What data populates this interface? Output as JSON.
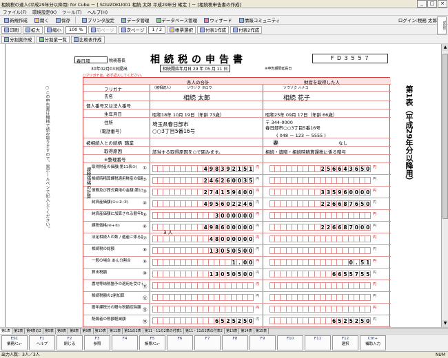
{
  "window": {
    "title": "相続税の達人(平成29年分以降用) for Cube － [ SOUZOKU001 相続 太郎 平成29年分 確定 ] － [相続税申告書の作成]"
  },
  "menu": [
    "ファイル(F)",
    "環境設定(K)",
    "ツール(T)",
    "ヘルプ(H)"
  ],
  "toolbar1": [
    {
      "label": "新規作成",
      "icon": "new-file-icon"
    },
    {
      "label": "開く",
      "icon": "open-folder-icon"
    },
    {
      "label": "保存",
      "icon": "save-icon"
    },
    {
      "label": "プリンタ設定",
      "icon": "printer-icon"
    },
    {
      "label": "データ管理",
      "icon": "database-icon"
    },
    {
      "label": "データベース管理",
      "icon": "database-manage-icon"
    },
    {
      "label": "ウィザード",
      "icon": "wizard-icon"
    },
    {
      "label": "情報コミュニティ",
      "icon": "community-icon"
    }
  ],
  "login": "ログイン:税務 太郎",
  "toolbar2": {
    "print": "印刷",
    "zoom_in": "拡大",
    "zoom_out": "縮小",
    "zoom": "100 %",
    "prev": "前ページ",
    "next": "次ページ",
    "page": "1 / 2",
    "sheet_select": "帳票選択",
    "attach_create": "付表1作成",
    "attach_create2": "付表2作成"
  },
  "toolbar3": {
    "split": "分割業作成",
    "split2": "分割業一覧",
    "compare": "比較表作成"
  },
  "tassei": "TASSEI",
  "form": {
    "title": "相続税の申告書",
    "fd": "ＦＤ３５５７",
    "office": "春日部",
    "office_label": "税務署長",
    "date_text": "30年02月03日提出",
    "death_date": "相続開始年月日 29 年 05 月 11 日",
    "page_label": "※申告期限延長日",
    "note": "○フリガナは、必ず記入してください。",
    "vertical_left": "○この申告書は機械で読み取りますので、黒ボールペンで記入してください。",
    "heir_header": "各人の合計",
    "prop_header": "財産を取得した人",
    "labels": {
      "furigana": "フリガナ",
      "name": "氏名",
      "mynumber": "個人番号又は法人番号",
      "birth": "生年月日",
      "address": "住所",
      "phone": "（電話番号）",
      "relation": "被相続人との続柄",
      "job": "職業",
      "cause": "取得原因",
      "ref": "※整理番号"
    },
    "deceased": {
      "kana": "ソウゾク タロウ",
      "name": "相続 太郎",
      "birth": "昭和18年 10月 19日（年齢 73歳）",
      "address1": "埼玉県春日部市",
      "address2": "○○3丁目5番16号",
      "tag": "（被相続人）"
    },
    "heir": {
      "kana": "ソウゾク ハナコ",
      "name": "相続 花子",
      "birth": "昭和25年 09月 17日（年齢 66歳）",
      "zip": "〒 344-0000",
      "address": "春日部市○○3丁目5番16号",
      "phone": "( 048 － 123 － 5555 )",
      "relation": "妻",
      "job": "なし",
      "cause": "相続・遺贈・相続時精算課税に係る贈与",
      "cause_all": "該当する取得原因を○で囲みます。"
    },
    "rows": [
      {
        "no": "①",
        "label": "取得財産の価額(第11表③)",
        "total": "498392151",
        "heir": "256643650"
      },
      {
        "no": "②",
        "label": "相続時精算課税適用財産の価額(第11の2表1⑦)",
        "total": "246260035",
        "heir": ""
      },
      {
        "no": "③",
        "label": "債務及び葬式費用の金額(第13表3⑦)",
        "total": "274159400",
        "heir": "335960000"
      },
      {
        "no": "④",
        "label": "純資産価額(①+②-③)",
        "total": "495602246",
        "heir": "226687650"
      },
      {
        "no": "⑤",
        "label": "純資産価額に加算される暦年課税分の贈与財産価額",
        "total": "3000000",
        "heir": ""
      },
      {
        "no": "⑥",
        "label": "課税価格(④+⑤)",
        "total": "498600000",
        "heir": "226687000"
      },
      {
        "no": "⑦",
        "label": "法定相続人の数 / 遺産に係る基礎控除額",
        "total": "48000000",
        "heir": ""
      },
      {
        "no": "⑧",
        "label": "相続税の総額",
        "total": "13050500",
        "heir": ""
      },
      {
        "no": "⑨",
        "label": "一般の場合 あん分割合",
        "total": "1.00",
        "heir": "0.51"
      },
      {
        "no": "⑩",
        "label": "算出税額",
        "total": "13050500",
        "heir": "6655755"
      },
      {
        "no": "⑪",
        "label": "農地等納税猶予の適用を受ける場合",
        "total": "",
        "heir": ""
      },
      {
        "no": "⑫",
        "label": "相続税額の2割加算",
        "total": "",
        "heir": ""
      },
      {
        "no": "⑬",
        "label": "暦年課税分の贈与税額控除額",
        "total": "",
        "heir": ""
      },
      {
        "no": "⑭",
        "label": "配偶者の税額軽減額",
        "total": "6525250",
        "heir": "6525250"
      }
    ],
    "rows_label": "課税価格の計算",
    "heirs_count": "3 人",
    "side_title": "第1表（平成29年分以降用）"
  },
  "tabs": [
    "第1表",
    "第2表",
    "第4表の2",
    "第5表",
    "第6表",
    "第8表",
    "第9表",
    "第10表",
    "第11表",
    "第11の2表",
    "第11・11の2表の付表1",
    "第11・11の2表の付表2",
    "第13表",
    "第14表",
    "第15表"
  ],
  "fkeys": [
    {
      "k": "ESC",
      "l": "業務ﾒﾆｭｰ"
    },
    {
      "k": "F1",
      "l": "ヘルプ"
    },
    {
      "k": "F2",
      "l": "閉じる"
    },
    {
      "k": "F3",
      "l": "参照"
    },
    {
      "k": "F4",
      "l": ""
    },
    {
      "k": "F5",
      "l": "帳票ﾒﾆｭｰ"
    },
    {
      "k": "F6",
      "l": ""
    },
    {
      "k": "F7",
      "l": ""
    },
    {
      "k": "F8",
      "l": ""
    },
    {
      "k": "F9",
      "l": ""
    },
    {
      "k": "F10",
      "l": ""
    },
    {
      "k": "F11",
      "l": ""
    },
    {
      "k": "F12",
      "l": "選択"
    },
    {
      "k": "Ctrl+",
      "l": "補助入力"
    }
  ],
  "status": {
    "text": "出力人数：3人／3人",
    "mode": "NUM"
  }
}
